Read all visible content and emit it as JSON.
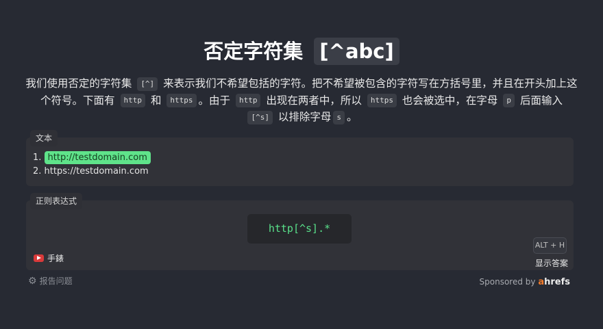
{
  "title": {
    "text": "否定字符集",
    "code": "[^abc]"
  },
  "description": {
    "p1": "我们使用否定的字符集",
    "c1": "[^]",
    "p2": "来表示我们不希望包括的字符。把不希望被包含的字符写在方括号里，并且在开头加上这个符号。下面有",
    "c2": "http",
    "p3": "和",
    "c3": "https",
    "p4": "。由于",
    "c4": "http",
    "p5": "出现在两者中，所以",
    "c5": "https",
    "p6": "也会被选中，在字母",
    "c6": "p",
    "p7": "后面输入",
    "c7": "[^s]",
    "p8": "以排除字母",
    "c8": "s",
    "p9": "。"
  },
  "text_panel": {
    "label": "文本",
    "line1_num": "1.",
    "line1_match": "http://testdomain.com",
    "line2": "2. https://testdomain.com"
  },
  "regex_panel": {
    "label": "正则表达式",
    "pattern": "http[^s].*",
    "youtube_label": "手錶",
    "shortcut": "ALT + H",
    "show_answer": "显示答案"
  },
  "footer": {
    "report": "报告问题",
    "sponsor_prefix": "Sponsored by",
    "sponsor_brand_a": "a",
    "sponsor_brand_rest": "hrefs"
  },
  "colors": {
    "background": "#272a33",
    "match": "#5fe38a",
    "regex_text": "#59e08a",
    "brand": "#f07a2b"
  }
}
